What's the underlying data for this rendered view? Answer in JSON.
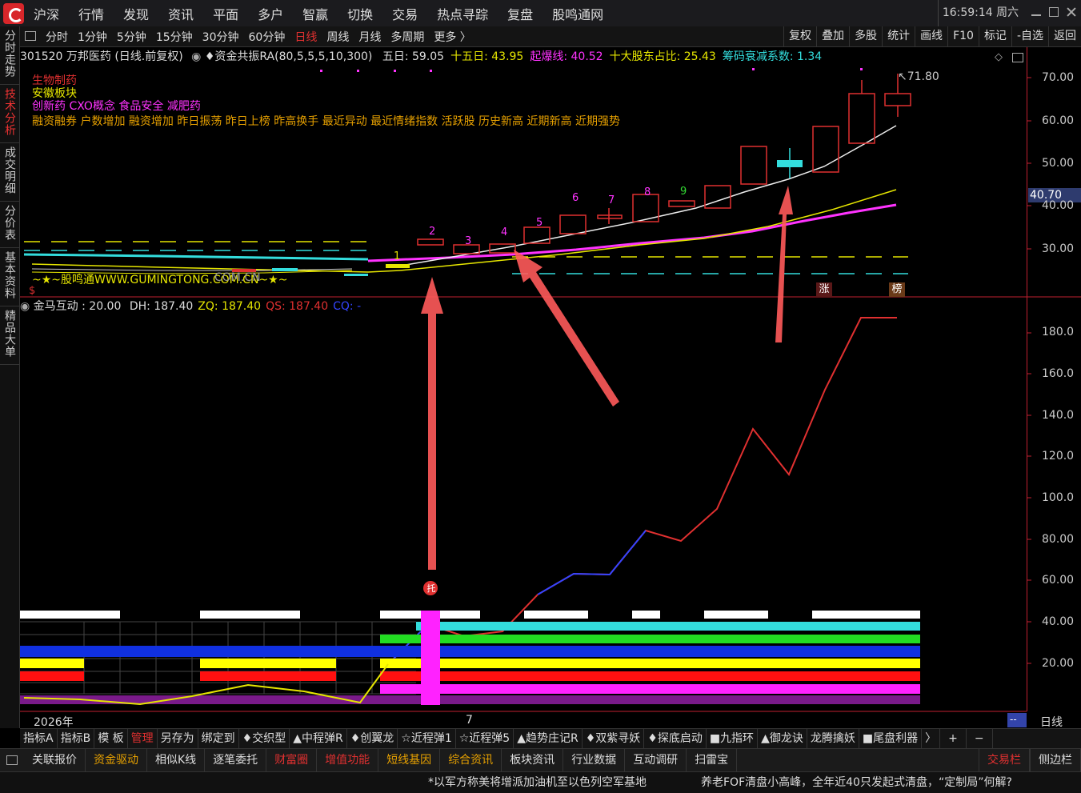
{
  "topbar": {
    "menu": [
      "沪深",
      "行情",
      "发现",
      "资讯",
      "平面",
      "多户",
      "智赢",
      "切换",
      "交易",
      "热点寻踪",
      "复盘",
      "股鸣通网"
    ],
    "clock": "16:59:14 周六"
  },
  "sidebar": {
    "tabs": [
      "分时走势",
      "技术分析",
      "成交明细",
      "分价表",
      "基本资料",
      "精品大单"
    ]
  },
  "period_bar": {
    "items": [
      "分时",
      "1分钟",
      "5分钟",
      "15分钟",
      "30分钟",
      "60分钟",
      "日线",
      "周线",
      "月线",
      "多周期",
      "更多 〉"
    ],
    "active": "日线",
    "right_items": [
      "复权",
      "叠加",
      "多股",
      "统计",
      "画线",
      "F10",
      "标记",
      "-自选",
      "返回"
    ]
  },
  "info": {
    "stock": "301520 万邦医药 (日线.前复权)",
    "indicator": "♦资金共振RA(80,5,5,5,10,300)",
    "fields": [
      {
        "label": "五日: 59.05",
        "color": "#dddddd"
      },
      {
        "label": "十五日: 43.95",
        "color": "#e6e600"
      },
      {
        "label": "起爆线: 40.52",
        "color": "#ff33ff"
      },
      {
        "label": "十大股东占比: 25.43",
        "color": "#e6e600"
      },
      {
        "label": "筹码衰减系数: 1.34",
        "color": "#33dddd"
      }
    ]
  },
  "plates": {
    "line1": "生物制药",
    "line2": "安徽板块",
    "line3": "创新药 CXO概念 食品安全 减肥药",
    "line4": "融资融券 户数增加 融资增加 昨日振荡 昨日上榜 昨高换手 最近异动 最近情绪指数 活跃股 历史新高 近期新高 近期强势"
  },
  "watermark": "~★~股鸣通WWW.GUMINGTONG.COM.CN~★~",
  "watermark_overlap": "COM.CN",
  "price_panel": {
    "max_label": "71.80",
    "current_price": "40.70",
    "y_ticks": [
      "70.00",
      "60.00",
      "50.00",
      "40.00",
      "30.00"
    ],
    "candle_numbers": [
      "1",
      "2",
      "3",
      "4",
      "5",
      "6",
      "7",
      "8",
      "9"
    ],
    "badges": [
      "涨",
      "榜"
    ],
    "dollar_mark": "$"
  },
  "sub_panel": {
    "title": "金马互动 : 20.00",
    "fields": [
      {
        "label": "DH: 187.40",
        "color": "#dddddd"
      },
      {
        "label": "ZQ: 187.40",
        "color": "#e6e600"
      },
      {
        "label": "QS: 187.40",
        "color": "#e03030"
      },
      {
        "label": "CQ: -",
        "color": "#3344ff"
      }
    ],
    "y_ticks": [
      "180.0",
      "160.0",
      "140.0",
      "120.0",
      "100.0",
      "80.00",
      "60.00",
      "40.00",
      "20.00"
    ],
    "badge": "托"
  },
  "x_axis": {
    "year": "2026年",
    "month": "7",
    "period_label": "日线",
    "scroll_label": "--"
  },
  "bottom_tabs": [
    "指标A",
    "指标B",
    "模 板",
    "管理",
    "另存为",
    "绑定到",
    "♦交织型",
    "▲中程弹R",
    "♦创翼龙",
    "☆近程弹1",
    "☆近程弹5",
    "▲趋势庄记R",
    "♦双紫寻妖",
    "♦探底启动",
    "■九指环",
    "▲御龙诀",
    "龙腾擒妖",
    "■尾盘利器",
    "〉",
    "+",
    "−"
  ],
  "func_bar": {
    "items": [
      {
        "label": "关联报价",
        "color": "#dddddd"
      },
      {
        "label": "资金驱动",
        "color": "#e6a000"
      },
      {
        "label": "相似K线",
        "color": "#dddddd"
      },
      {
        "label": "逐笔委托",
        "color": "#dddddd"
      },
      {
        "label": "财富圈",
        "color": "#e03030"
      },
      {
        "label": "增值功能",
        "color": "#e03030"
      },
      {
        "label": "短线基因",
        "color": "#e6a000"
      },
      {
        "label": "综合资讯",
        "color": "#e6a000"
      },
      {
        "label": "板块资讯",
        "color": "#dddddd"
      },
      {
        "label": "行业数据",
        "color": "#dddddd"
      },
      {
        "label": "互动调研",
        "color": "#dddddd"
      },
      {
        "label": "扫雷宝",
        "color": "#dddddd"
      }
    ],
    "right": [
      "交易栏",
      "侧边栏"
    ]
  },
  "ticker": {
    "news1": "*以军方称美将增派加油机至以色列空军基地",
    "news2": "养老FOF清盘小高峰，全年近40只发起式清盘，“定制局”何解?"
  }
}
